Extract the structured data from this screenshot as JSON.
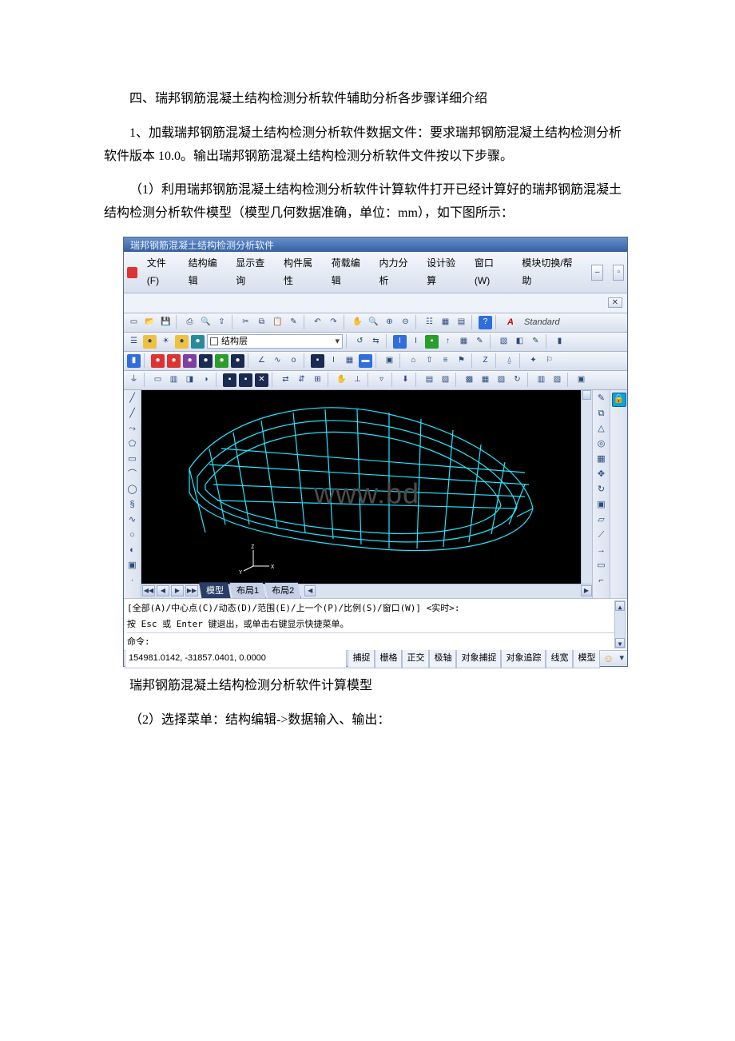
{
  "doc": {
    "heading": "四、瑞邦钢筋混凝土结构检测分析软件辅助分析各步骤详细介绍",
    "p1": "1、加载瑞邦钢筋混凝土结构检测分析软件数据文件：要求瑞邦钢筋混凝土结构检测分析软件版本 10.0。输出瑞邦钢筋混凝土结构检测分析软件文件按以下步骤。",
    "p2": "（1）利用瑞邦钢筋混凝土结构检测分析软件计算软件打开已经计算好的瑞邦钢筋混凝土结构检测分析软件模型（模型几何数据准确，单位：mm），如下图所示：",
    "caption1": "瑞邦钢筋混凝土结构检测分析软件计算模型",
    "p3": "（2）选择菜单：结构编辑->数据输入、输出："
  },
  "app": {
    "title": "瑞邦钢筋混凝土结构检测分析软件",
    "menus": {
      "file": "文件(F)",
      "struct_edit": "结构编辑",
      "show_query": "显示查询",
      "member_prop": "构件属性",
      "load_edit": "荷载编辑",
      "force_analysis": "内力分析",
      "design_check": "设计验算",
      "window": "窗口(W)",
      "module_help": "模块切换/帮助"
    },
    "standard_label": "Standard",
    "layer_combo": "结构层",
    "watermark": "www.bd",
    "tabs": {
      "model": "模型",
      "layout1": "布局1",
      "layout2": "布局2"
    },
    "cmd": {
      "line1": "[全部(A)/中心点(C)/动态(D)/范围(E)/上一个(P)/比例(S)/窗口(W)] <实时>:",
      "line2": "按 Esc 或 Enter 键退出，或单击右键显示快捷菜单。",
      "prompt": "命令:"
    },
    "status": {
      "coords": "154981.0142, -31857.0401, 0.0000",
      "snap": "捕捉",
      "grid": "栅格",
      "ortho": "正交",
      "polar": "极轴",
      "osnap": "对象捕捉",
      "otrack": "对象追踪",
      "lwt": "线宽",
      "model": "模型"
    }
  }
}
